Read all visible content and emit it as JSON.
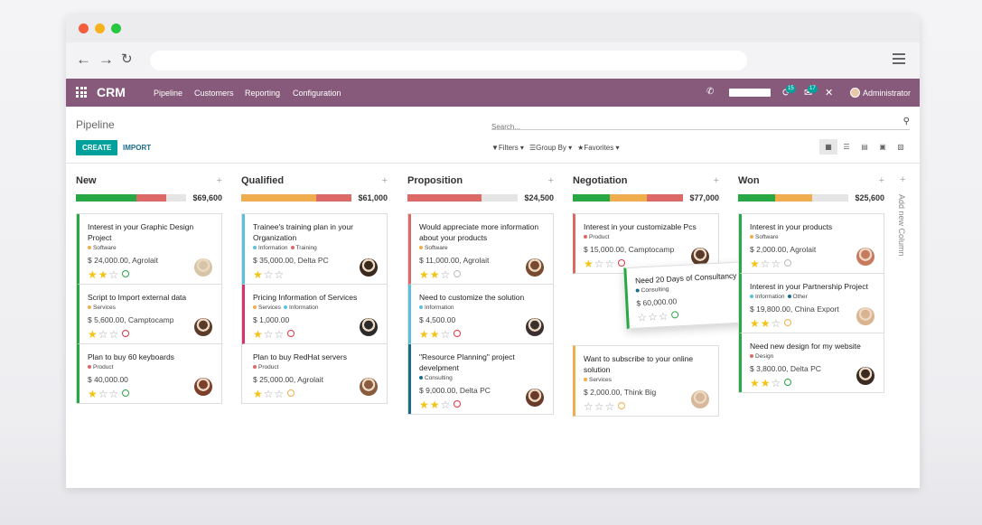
{
  "topbar": {
    "app_name": "CRM",
    "menu": [
      "Pipeline",
      "Customers",
      "Reporting",
      "Configuration"
    ],
    "chat_badge": "15",
    "activity_badge": "17",
    "user": "Administrator"
  },
  "control": {
    "breadcrumb": "Pipeline",
    "create_label": "CREATE",
    "import_label": "IMPORT",
    "search_placeholder": "Search...",
    "filters_label": "Filters",
    "group_by_label": "Group By",
    "favorites_label": "Favorites"
  },
  "colors": {
    "brand": "#875a7b",
    "primary": "#00a09d",
    "won": "#28a745",
    "planned": "#f0ad4e",
    "overdue": "#dc6965"
  },
  "columns": [
    {
      "title": "New",
      "total": "$69,600",
      "progress": [
        {
          "color": "#28a745",
          "fraction": 0.55
        },
        {
          "color": "#dc6965",
          "fraction": 0.27
        }
      ],
      "cards": [
        {
          "title": "Interest in your Graphic Design Project",
          "tags": [
            {
              "name": "Software",
              "color": "#f0ad4e"
            }
          ],
          "amount": "$ 24,000.00, Agrolait",
          "stars": 2,
          "activity": "green",
          "border": "#28a745",
          "avatar": "#d6c5a6"
        },
        {
          "title": "Script to Import external data",
          "tags": [
            {
              "name": "Services",
              "color": "#f0ad4e"
            }
          ],
          "amount": "$ 5,600.00, Camptocamp",
          "stars": 1,
          "activity": "red",
          "border": "#28a745",
          "avatar": "#5a3b29"
        },
        {
          "title": "Plan to buy 60 keyboards",
          "tags": [
            {
              "name": "Product",
              "color": "#dc6965"
            }
          ],
          "amount": "$ 40,000.00",
          "stars": 1,
          "activity": "green",
          "border": "#28a745",
          "avatar": "#7b3f2a"
        }
      ]
    },
    {
      "title": "Qualified",
      "total": "$61,000",
      "progress": [
        {
          "color": "#f0ad4e",
          "fraction": 0.68
        },
        {
          "color": "#dc6965",
          "fraction": 0.32
        }
      ],
      "cards": [
        {
          "title": "Trainee's training plan in your Organization",
          "tags": [
            {
              "name": "Information",
              "color": "#5bc0de"
            },
            {
              "name": "Training",
              "color": "#dc6965"
            }
          ],
          "amount": "$ 35,000.00, Delta PC",
          "stars": 1,
          "activity": "none",
          "border": "#5bc0de",
          "avatar": "#3a2a1e"
        },
        {
          "title": "Pricing Information of Services",
          "tags": [
            {
              "name": "Services",
              "color": "#f0ad4e"
            },
            {
              "name": "Information",
              "color": "#5bc0de"
            }
          ],
          "amount": "$ 1,000.00",
          "stars": 1,
          "activity": "red",
          "border": "#d6336c",
          "avatar": "#2b2b2b"
        },
        {
          "title": "Plan to buy RedHat servers",
          "tags": [
            {
              "name": "Product",
              "color": "#dc6965"
            }
          ],
          "amount": "$ 25,000.00, Agrolait",
          "stars": 1,
          "activity": "orange",
          "border": "transparent",
          "avatar": "#8a5b3c"
        }
      ]
    },
    {
      "title": "Proposition",
      "total": "$24,500",
      "progress": [
        {
          "color": "#dc6965",
          "fraction": 0.67
        }
      ],
      "cards": [
        {
          "title": "Would appreciate more information about your products",
          "tags": [
            {
              "name": "Software",
              "color": "#f0ad4e"
            }
          ],
          "amount": "$ 11,000.00, Agrolait",
          "stars": 2,
          "activity": "grey",
          "border": "#dc6965",
          "avatar": "#7a4a2e"
        },
        {
          "title": "Need to customize the solution",
          "tags": [
            {
              "name": "Information",
              "color": "#5bc0de"
            }
          ],
          "amount": "$ 4,500.00",
          "stars": 2,
          "activity": "red",
          "border": "#5bc0de",
          "avatar": "#3b3030"
        },
        {
          "title": "\"Resource Planning\" project develpment",
          "tags": [
            {
              "name": "Consulting",
              "color": "#1b6c8b"
            }
          ],
          "amount": "$ 9,000.00, Delta PC",
          "stars": 2,
          "activity": "red",
          "border": "#1b6c8b",
          "avatar": "#6a3b2a"
        }
      ]
    },
    {
      "title": "Negotiation",
      "total": "$77,000",
      "progress": [
        {
          "color": "#28a745",
          "fraction": 0.34
        },
        {
          "color": "#f0ad4e",
          "fraction": 0.33
        },
        {
          "color": "#dc6965",
          "fraction": 0.33
        }
      ],
      "cards": [
        {
          "title": "Interest in your customizable Pcs",
          "tags": [
            {
              "name": "Product",
              "color": "#dc6965"
            }
          ],
          "amount": "$ 15,000.00, Camptocamp",
          "stars": 1,
          "activity": "red",
          "border": "#dc6965",
          "avatar": "#5a3b29"
        },
        {
          "title": "Want to subscribe to your online solution",
          "tags": [
            {
              "name": "Services",
              "color": "#f0ad4e"
            }
          ],
          "amount": "$ 2,000.00, Think Big",
          "stars": 0,
          "activity": "orange",
          "border": "#f0ad4e",
          "avatar": "#d7b89a"
        }
      ],
      "floating": {
        "title": "Need 20 Days of Consultancy",
        "tags": [
          {
            "name": "Consulting",
            "color": "#1b6c8b"
          }
        ],
        "amount": "$ 60,000.00",
        "stars": 0,
        "activity": "green",
        "avatar": "#c9a27e"
      }
    },
    {
      "title": "Won",
      "total": "$25,600",
      "progress": [
        {
          "color": "#28a745",
          "fraction": 0.34
        },
        {
          "color": "#f0ad4e",
          "fraction": 0.33
        }
      ],
      "cards": [
        {
          "title": "Interest in your products",
          "tags": [
            {
              "name": "Software",
              "color": "#f0ad4e"
            }
          ],
          "amount": "$ 2,000.00, Agrolait",
          "stars": 1,
          "activity": "grey",
          "border": "#28a745",
          "avatar": "#c87a5e"
        },
        {
          "title": "Interest in your Partnership Project",
          "tags": [
            {
              "name": "Information",
              "color": "#5bc0de"
            },
            {
              "name": "Other",
              "color": "#1b6c8b"
            }
          ],
          "amount": "$ 19,800.00, China Export",
          "stars": 2,
          "activity": "orange",
          "border": "#28a745",
          "avatar": "#d9b48f"
        },
        {
          "title": "Need new design for my website",
          "tags": [
            {
              "name": "Design",
              "color": "#dc6965"
            }
          ],
          "amount": "$ 3,800.00, Delta PC",
          "stars": 2,
          "activity": "green",
          "border": "#28a745",
          "avatar": "#3b2a20"
        }
      ]
    }
  ],
  "add_column_label": "Add new Column"
}
